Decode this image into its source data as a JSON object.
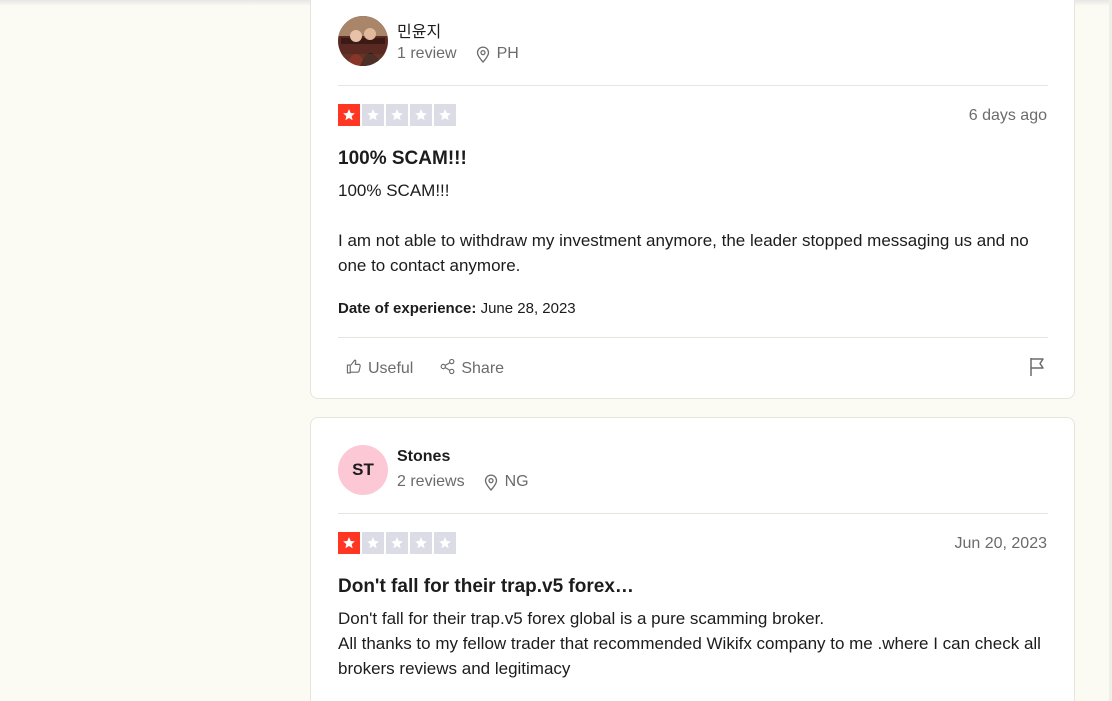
{
  "reviews": [
    {
      "author": "민윤지",
      "review_count": "1 review",
      "location": "PH",
      "rating": 1,
      "date": "6 days ago",
      "title": "100% SCAM!!!",
      "body": [
        "100% SCAM!!!",
        "",
        "I am not able to withdraw my investment anymore, the leader stopped messaging us and no one to contact anymore."
      ],
      "experience_label": "Date of experience:",
      "experience_date": "June 28, 2023",
      "useful_label": "Useful",
      "share_label": "Share"
    },
    {
      "author": "Stones",
      "initials": "ST",
      "review_count": "2 reviews",
      "location": "NG",
      "rating": 1,
      "date": "Jun 20, 2023",
      "title": "Don't fall for their trap.v5 forex…",
      "body": [
        "Don't fall for their trap.v5 forex global is a pure scamming broker.",
        "All thanks to my fellow trader that recommended Wikifx company to me .where I can check all brokers reviews and legitimacy"
      ]
    }
  ],
  "colors": {
    "star_on": "#ff3722",
    "star_off": "#dcdce6",
    "avatar_st": "#fcc8d6",
    "page_bg": "#fcfbf3"
  },
  "icons": [
    "location-pin-icon",
    "star-icon",
    "thumbs-up-icon",
    "share-icon",
    "flag-icon"
  ]
}
